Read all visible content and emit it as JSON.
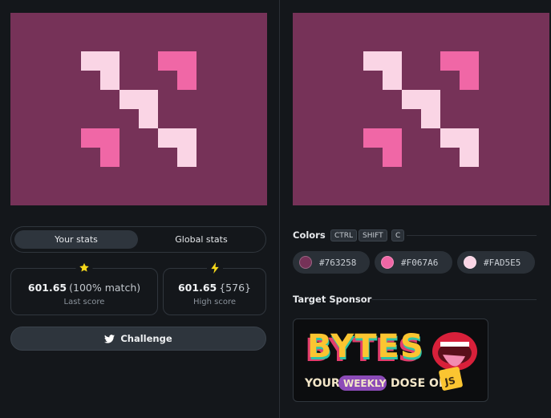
{
  "stats": {
    "tab_your": "Your stats",
    "tab_global": "Global stats",
    "last_score_value": "601.65",
    "last_score_match": "(100% match)",
    "last_score_label": "Last score",
    "high_score_value": "601.65",
    "high_score_rank": "{576}",
    "high_score_label": "High score",
    "challenge_label": "Challenge"
  },
  "colors_section": {
    "title": "Colors",
    "shortcut_keys": [
      "CTRL",
      "SHIFT",
      "C"
    ],
    "swatches": [
      {
        "hex": "#763258"
      },
      {
        "hex": "#F067A6"
      },
      {
        "hex": "#FAD5E5"
      }
    ]
  },
  "sponsor": {
    "title": "Target Sponsor",
    "logo_word": "BYTES",
    "tagline_your": "YOUR",
    "tagline_weekly": "WEEKLY",
    "tagline_dose": "DOSE OF",
    "tagline_js": "JS"
  },
  "palette": {
    "background": "#763258",
    "accent": "#F067A6",
    "light": "#FAD5E5",
    "star": "#f5d71a"
  }
}
